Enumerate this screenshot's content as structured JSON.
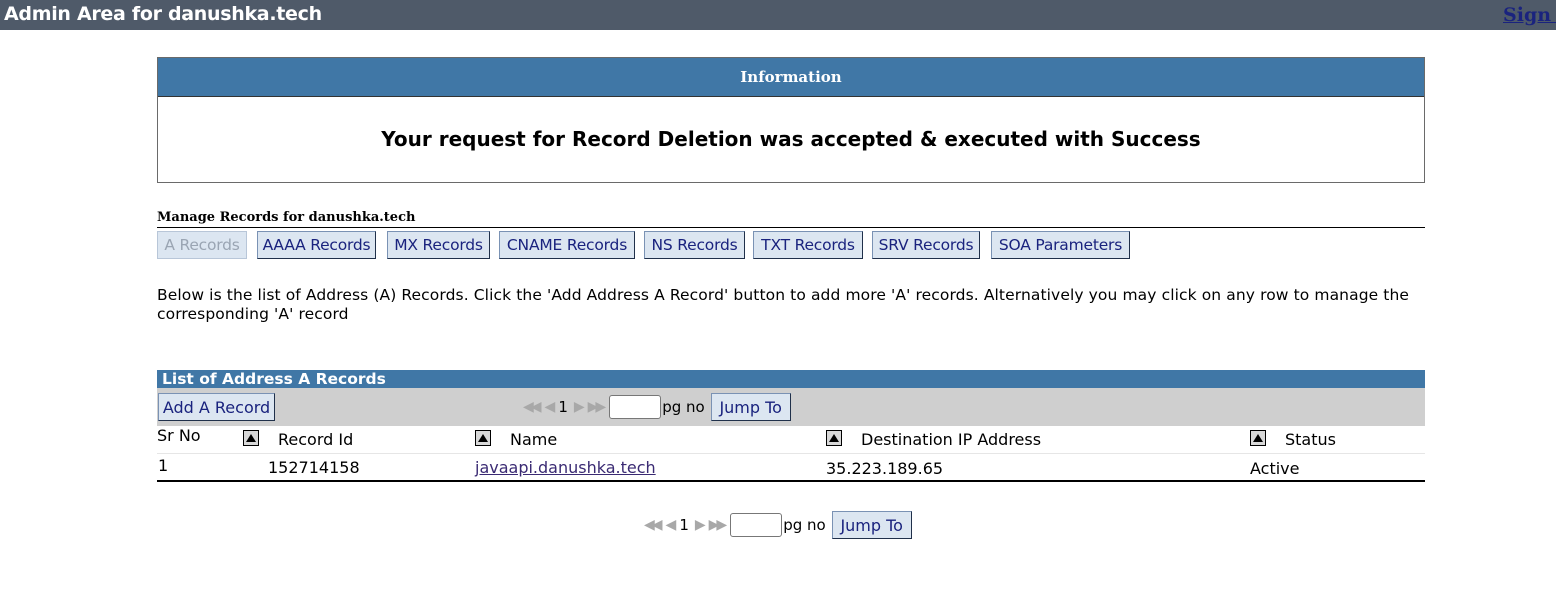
{
  "header": {
    "title": "Admin Area for danushka.tech",
    "signout": "Sign out"
  },
  "info": {
    "heading": "Information",
    "message": "Your request for Record Deletion was accepted & executed with Success"
  },
  "manage": {
    "title": "Manage Records for danushka.tech",
    "tabs": [
      "A Records",
      "AAAA Records",
      "MX Records",
      "CNAME Records",
      "NS Records",
      "TXT Records",
      "SRV Records",
      "SOA Parameters"
    ],
    "active_tab": "A Records"
  },
  "description": "Below is the list of Address (A) Records. Click the 'Add Address A Record' button to add more 'A' records. Alternatively you may click on any row to manage the corresponding 'A' record",
  "list": {
    "heading": "List of Address A Records",
    "add_button": "Add A Record",
    "pager": {
      "page": "1",
      "pg_label": "pg no",
      "jump_label": "Jump To",
      "first": "◀◀",
      "prev": "◀",
      "next": "▶",
      "last": "▶▶"
    },
    "columns": [
      "Sr No",
      "Record Id",
      "Name",
      "Destination IP Address",
      "Status"
    ],
    "rows": [
      {
        "sr": "1",
        "record_id": "152714158",
        "name": "javaapi.danushka.tech",
        "ip": "35.223.189.65",
        "status": "Active"
      }
    ]
  }
}
